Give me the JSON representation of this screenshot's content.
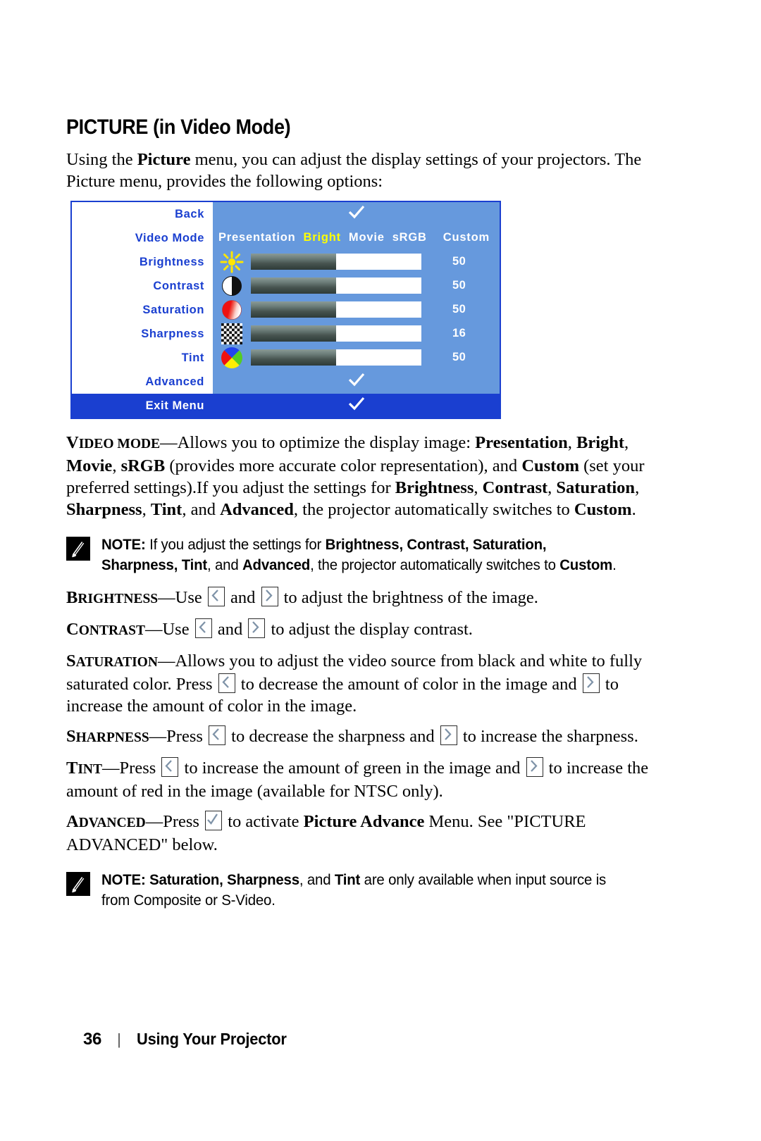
{
  "heading": "PICTURE (in Video Mode)",
  "intro": {
    "part1": "Using the ",
    "bold1": "Picture",
    "part2": " menu, you can adjust the display settings of your projectors. The Picture menu, provides the following options:"
  },
  "osd": {
    "back_label": "Back",
    "back_value_icon": "check-icon",
    "video_mode_label": "Video Mode",
    "video_modes": [
      "Presentation",
      "Bright",
      "Movie",
      "sRGB",
      "Custom"
    ],
    "video_mode_selected": "Bright",
    "selected_color": "#ffff00",
    "rows": [
      {
        "label": "Brightness",
        "icon": "sun-icon",
        "value": "50",
        "fill_percent": 50
      },
      {
        "label": "Contrast",
        "icon": "contrast-circle-icon",
        "value": "50",
        "fill_percent": 50
      },
      {
        "label": "Saturation",
        "icon": "saturation-circle-icon",
        "value": "50",
        "fill_percent": 50
      },
      {
        "label": "Sharpness",
        "icon": "checkerboard-icon",
        "value": "16",
        "fill_percent": 50
      },
      {
        "label": "Tint",
        "icon": "color-wheel-icon",
        "value": "50",
        "fill_percent": 50
      }
    ],
    "advanced_label": "Advanced",
    "advanced_value_icon": "check-icon",
    "exit_label": "Exit Menu",
    "exit_value_icon": "check-icon",
    "colors": {
      "panel_bg": "#6699dd",
      "label_bg": "#ffffff",
      "label_text": "#1a3fd0",
      "border": "#1a3fd0",
      "exit_bg": "#1a3fd0"
    }
  },
  "video_mode_para": {
    "term_cap": "V",
    "term_sc": "IDEO MODE",
    "t1": "—Allows you to optimize the display image: ",
    "b1": "Presentation",
    "t2": ", ",
    "b2": "Bright",
    "t3": ", ",
    "b3": "Movie",
    "t4": ", ",
    "b4": "sRGB",
    "t5": " (provides more accurate color representation), and ",
    "b5": "Custom",
    "t6": " (set your preferred settings).If you adjust the settings for ",
    "b6": "Brightness",
    "t7": ", ",
    "b7": "Contrast",
    "t8": ", ",
    "b8": "Saturation",
    "t9": ", ",
    "b9": "Sharpness",
    "t10": ", ",
    "b10": "Tint",
    "t11": ", and ",
    "b11": "Advanced",
    "t12": ", the projector automatically switches to ",
    "b12": "Custom",
    "t13": "."
  },
  "note1": {
    "icon": "note-pencil-icon",
    "label": "NOTE:",
    "t1": " If you adjust the settings for ",
    "b1": "Brightness, Contrast, Saturation, Sharpness, Tint",
    "t2": ", and ",
    "b2": "Advanced",
    "t3": ", the projector automatically switches to ",
    "b3": "Custom",
    "t4": "."
  },
  "brightness_para": {
    "term_cap": "B",
    "term_sc": "RIGHTNESS",
    "t1": "—Use ",
    "icon_left": "left-arrow-key-icon",
    "t2": " and ",
    "icon_right": "right-arrow-key-icon",
    "t3": " to adjust the brightness of the image."
  },
  "contrast_para": {
    "term_cap": "C",
    "term_sc": "ONTRAST",
    "t1": "—Use ",
    "icon_left": "left-arrow-key-icon",
    "t2": " and ",
    "icon_right": "right-arrow-key-icon",
    "t3": " to adjust the display contrast."
  },
  "saturation_para": {
    "term_cap": "S",
    "term_sc": "ATURATION",
    "t1": "—Allows you to adjust the video source from black and white to fully saturated color. Press ",
    "icon_left": "left-arrow-key-icon",
    "t2": " to decrease the amount of color in the image and ",
    "icon_right": "right-arrow-key-icon",
    "t3": " to increase the amount of color in the image."
  },
  "sharpness_para": {
    "term_cap": "S",
    "term_sc": "HARPNESS",
    "t1": "—Press ",
    "icon_left": "left-arrow-key-icon",
    "t2": " to decrease the sharpness and ",
    "icon_right": "right-arrow-key-icon",
    "t3": " to increase the sharpness."
  },
  "tint_para": {
    "term_cap": "T",
    "term_sc": "INT",
    "t1": "—Press ",
    "icon_left": "left-arrow-key-icon",
    "t2": " to increase the amount of green in the image and ",
    "icon_right": "right-arrow-key-icon",
    "t3": " to increase the amount of red in the image (available for NTSC only)."
  },
  "advanced_para": {
    "term_cap": "A",
    "term_sc": "DVANCED",
    "t1": "—Press ",
    "icon_check": "check-key-icon",
    "t2": " to activate ",
    "b1": "Picture Advance",
    "t3": " Menu. See \"PICTURE ADVANCED\" below."
  },
  "note2": {
    "icon": "note-pencil-icon",
    "label": "NOTE:",
    "t1": " ",
    "b1": "Saturation, Sharpness",
    "t2": ", and ",
    "b2": "Tint",
    "t3": " are only available when input source is from Composite or S-Video."
  },
  "footer": {
    "page_number": "36",
    "separator": "|",
    "title": "Using Your Projector"
  }
}
